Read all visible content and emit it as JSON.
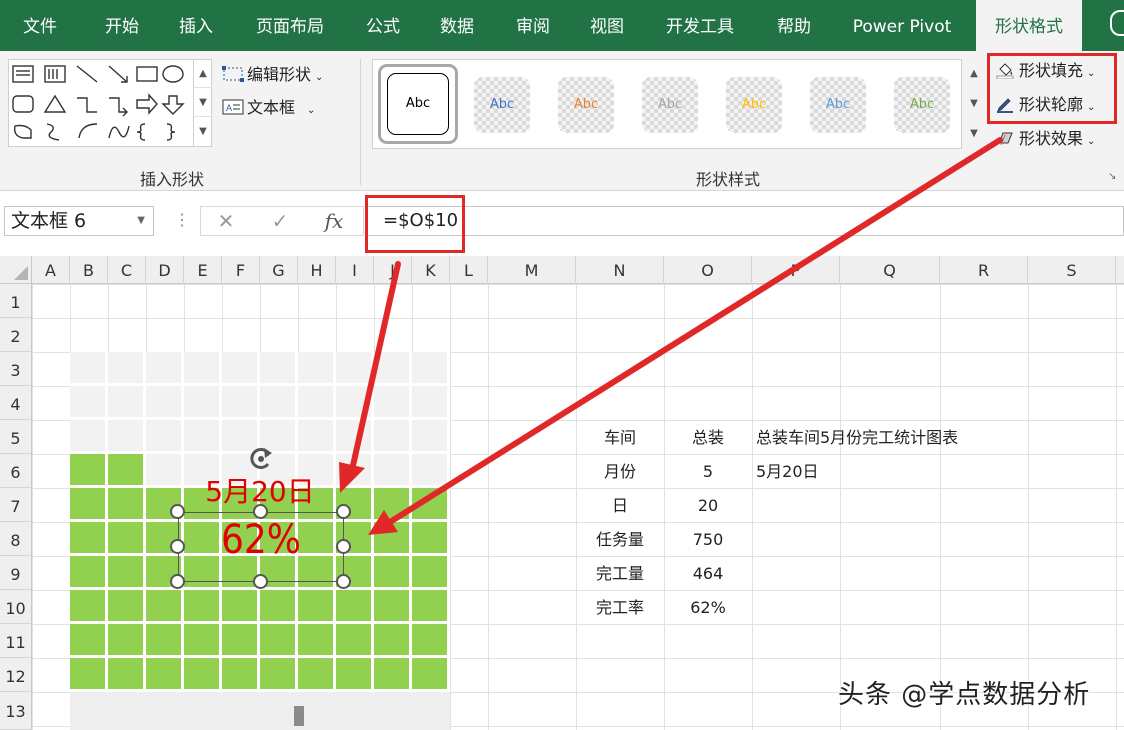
{
  "tabs": [
    {
      "label": "文件"
    },
    {
      "label": "开始"
    },
    {
      "label": "插入"
    },
    {
      "label": "页面布局"
    },
    {
      "label": "公式"
    },
    {
      "label": "数据"
    },
    {
      "label": "审阅"
    },
    {
      "label": "视图"
    },
    {
      "label": "开发工具"
    },
    {
      "label": "帮助"
    },
    {
      "label": "Power Pivot"
    },
    {
      "label": "形状格式"
    }
  ],
  "active_tab": "形状格式",
  "ribbon": {
    "insert_shapes": {
      "edit_shape": "编辑形状",
      "text_box": "文本框",
      "group_label": "插入形状"
    },
    "shape_styles": {
      "swatches": [
        "Abc",
        "Abc",
        "Abc",
        "Abc",
        "Abc",
        "Abc",
        "Abc"
      ],
      "swatch_colors": [
        "#000000",
        "#4472c4",
        "#ed7d31",
        "#a5a5a5",
        "#ffc000",
        "#5b9bd5",
        "#70ad47"
      ],
      "group_label": "形状样式",
      "shape_fill": "形状填充",
      "shape_outline": "形状轮廓",
      "shape_effects": "形状效果"
    }
  },
  "formula_bar": {
    "name_box": "文本框 6",
    "cancel": "✕",
    "enter": "✓",
    "fx": "fx",
    "formula": "=$O$10"
  },
  "columns": [
    "A",
    "B",
    "C",
    "D",
    "E",
    "F",
    "G",
    "H",
    "I",
    "J",
    "K",
    "L",
    "M",
    "N",
    "O",
    "P",
    "Q",
    "R",
    "S"
  ],
  "rows": [
    "1",
    "2",
    "3",
    "4",
    "5",
    "6",
    "7",
    "8",
    "9",
    "10",
    "11",
    "12",
    "13"
  ],
  "table": {
    "labels": [
      "车间",
      "月份",
      "日",
      "任务量",
      "完工量",
      "完工率"
    ],
    "values": [
      "总装",
      "5",
      "20",
      "750",
      "464",
      "62%"
    ],
    "title": "总装车间5月份完工统计图表",
    "date": "5月20日"
  },
  "waffle": {
    "completion_rate": 0.62,
    "fill_color": "#92d050",
    "empty_color": "#f2f2f2"
  },
  "overlay": {
    "date_label": "5月20日",
    "percent": "62%"
  },
  "watermark": "头条 @学点数据分析",
  "colors": {
    "excel_green": "#217346",
    "highlight_red": "#e02828",
    "label_red": "#e00000"
  }
}
